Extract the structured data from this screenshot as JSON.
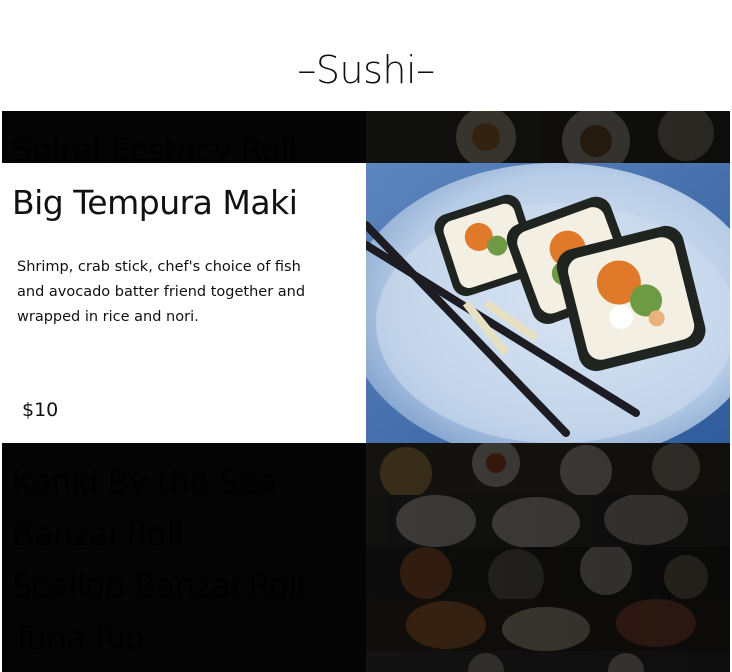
{
  "page": {
    "heading": "–Sushi–"
  },
  "menu": {
    "collapsed_above": [
      {
        "title": "Spiral Ecstacy Roll"
      }
    ],
    "expanded": {
      "title": "Big Tempura Maki",
      "description": "Shrimp, crab stick, chef's choice of fish and avocado batter friend together and wrapped in rice and nori.",
      "price": "$10"
    },
    "collapsed_below": [
      {
        "title": "Kanki By the Sea"
      },
      {
        "title": "Banzai Roll"
      },
      {
        "title": "Scallop Banzai Roll"
      },
      {
        "title": "Tuna Rio"
      }
    ]
  },
  "colors": {
    "collapsed_overlay": "#1a1a1a",
    "plate_blue": "#8fb2dc",
    "nori": "#1f2421",
    "rice": "#f3efe3",
    "roe": "#e07a2a",
    "avocado": "#6f9a45"
  },
  "icons": {
    "item_images": [
      "sushi-photo",
      "sushi-photo",
      "sushi-photo",
      "sushi-photo",
      "sushi-photo",
      "sushi-photo"
    ]
  }
}
